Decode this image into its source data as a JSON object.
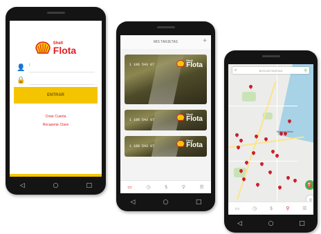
{
  "phones": {
    "login": {
      "brand_small": "Shell",
      "brand_large": "Flota",
      "user_icon": "user-icon",
      "lock_icon": "lock-icon",
      "user_value": "I",
      "enter_label": "ENTRAR",
      "create_account": "Crear Cuenta",
      "recover_key": "Recuperar Clave"
    },
    "cards": {
      "header": "MIS TARJETAS",
      "add": "+",
      "items": [
        {
          "number": "1 106 543 87",
          "brand_small": "Shell",
          "brand_large": "Flota"
        },
        {
          "number": "1 106 543 87",
          "brand_small": "Shell",
          "brand_large": "Flota"
        },
        {
          "number": "1 106 543 87",
          "brand_small": "Shell",
          "brand_large": "Flota"
        }
      ]
    },
    "map": {
      "search_placeholder": "BUSCAR NUEVAS",
      "city_label": "Buenos Aires"
    }
  },
  "colors": {
    "shell_red": "#dd1d21",
    "shell_yellow": "#f5c400",
    "map_green": "#4caf50"
  }
}
